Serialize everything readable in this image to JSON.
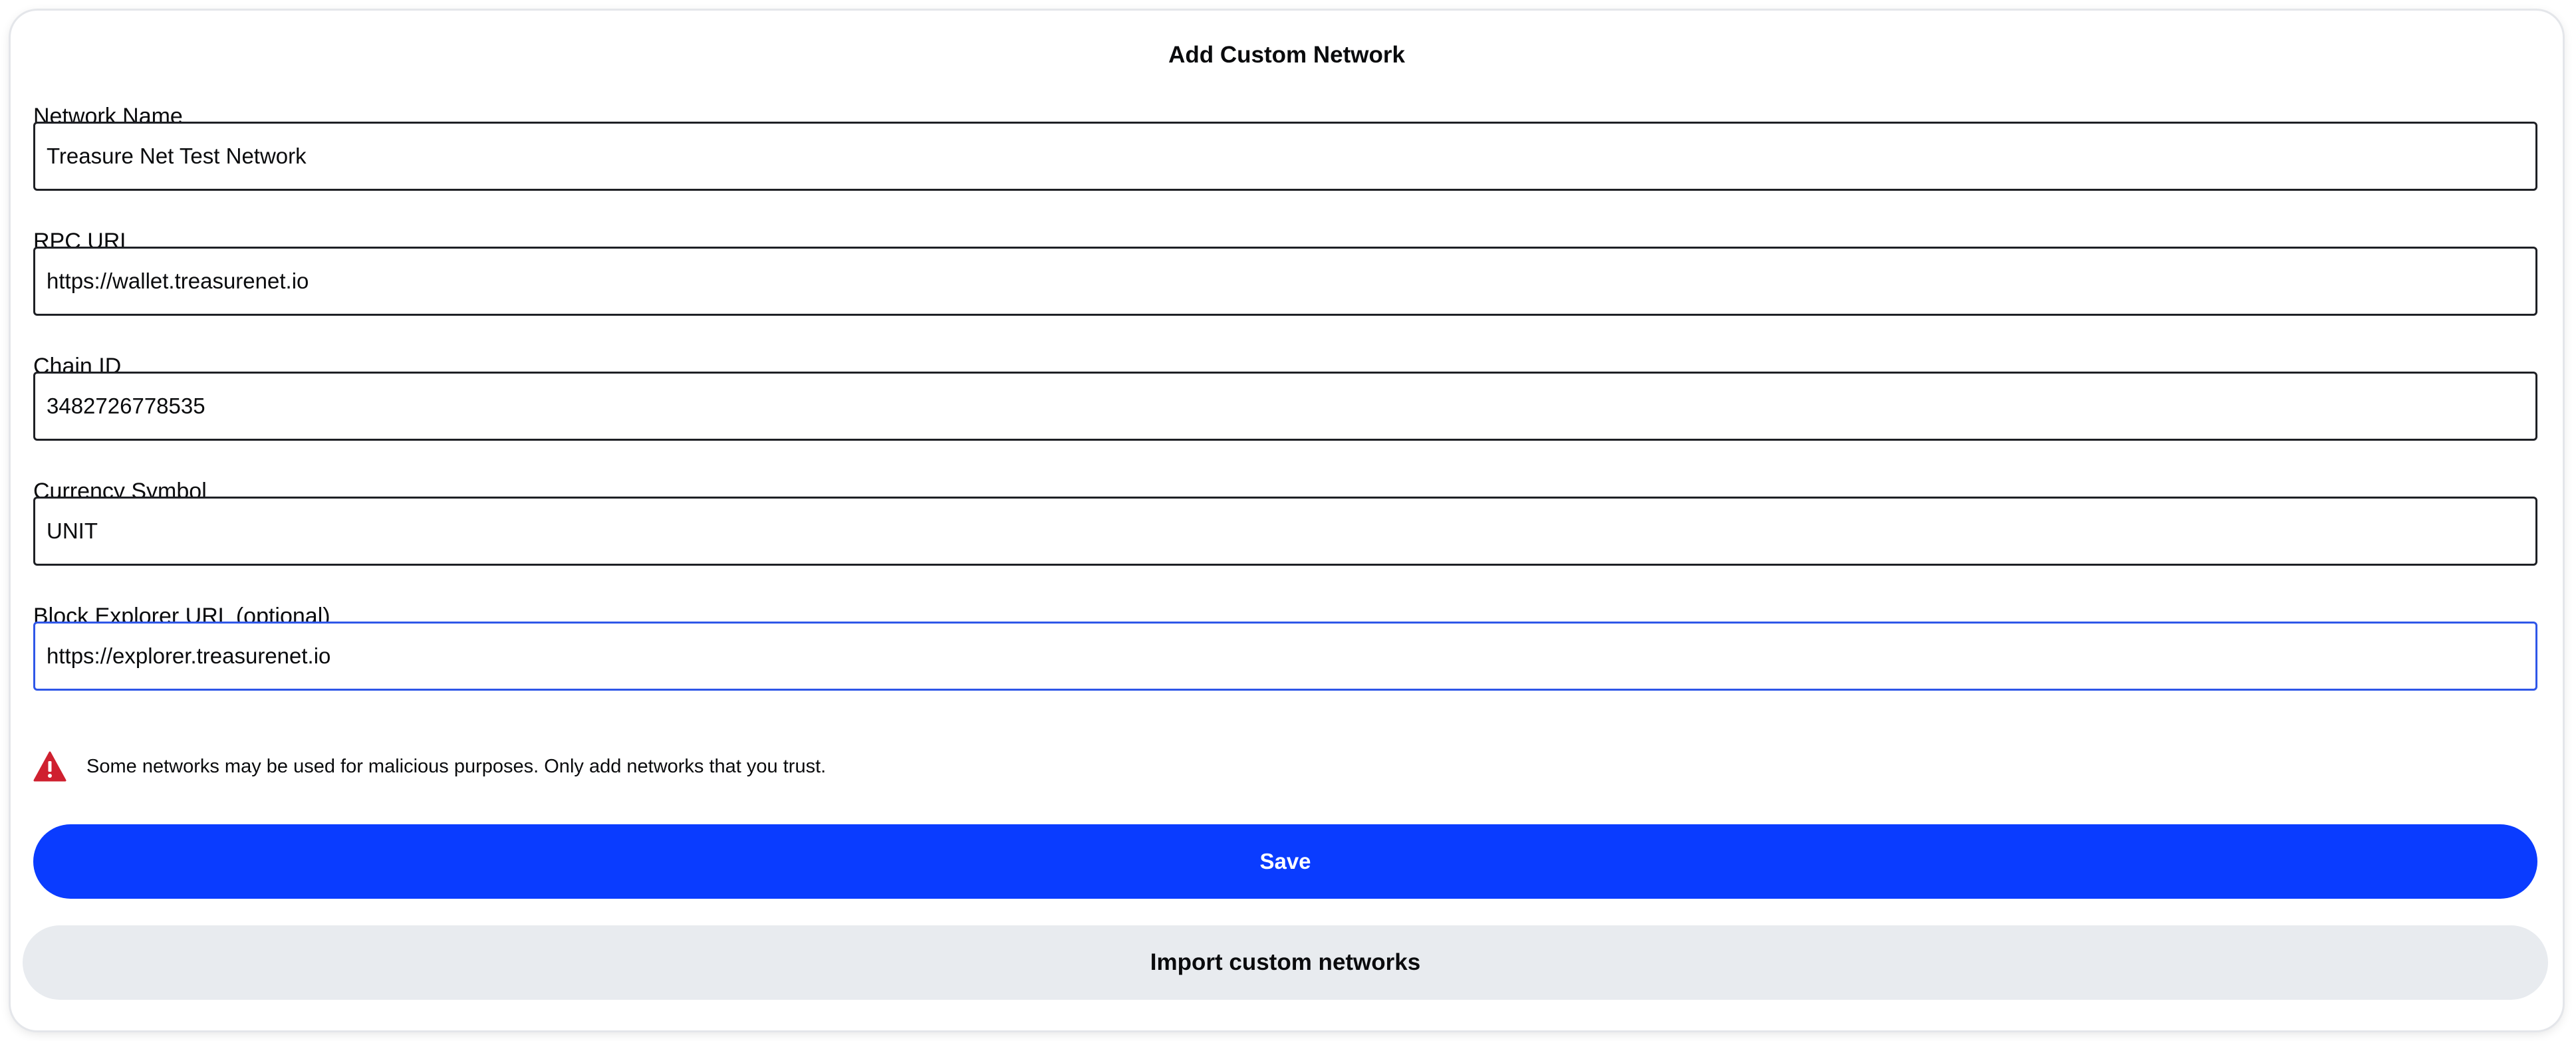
{
  "dialog": {
    "title": "Add Custom Network"
  },
  "fields": [
    {
      "label": "Network Name",
      "value": "Treasure Net Test Network"
    },
    {
      "label": "RPC URL",
      "value": "https://wallet.treasurenet.io"
    },
    {
      "label": "Chain ID",
      "value": "3482726778535"
    },
    {
      "label": "Currency Symbol",
      "value": "UNIT"
    },
    {
      "label": "Block Explorer URL (optional)",
      "value": "https://explorer.treasurenet.io"
    }
  ],
  "warning": {
    "icon": "warning-triangle-icon",
    "color": "#cf202f",
    "text": "Some networks may be used for malicious purposes. Only add networks that you trust."
  },
  "actions": {
    "save_label": "Save",
    "save_color": "#0a3cff",
    "import_label": "Import custom networks",
    "import_color": "#e8ebef"
  }
}
